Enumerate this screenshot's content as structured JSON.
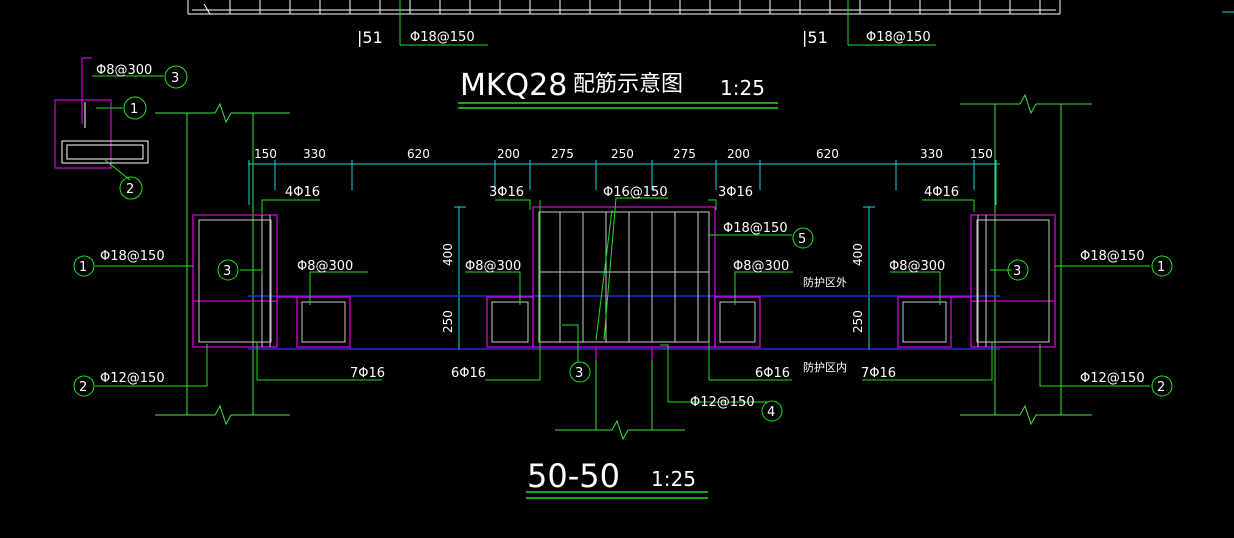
{
  "colors": {
    "background": "#000000",
    "text": "#ffffff",
    "leader": "#1fe01f",
    "concrete_outline": "#d000d0",
    "rebar": "#c8c8c8",
    "dimension": "#14d8d8",
    "protection_zone": "#3030ff",
    "axis_lines": "#40e040"
  },
  "top_strip": {
    "left": {
      "section_mark": "|51",
      "rebar_label": "Φ18@150"
    },
    "right": {
      "section_mark": "|51",
      "rebar_label": "Φ18@150"
    }
  },
  "plan_title": {
    "name": "MKQ28",
    "subtitle": "配筋示意图",
    "scale": "1:25"
  },
  "section_title": {
    "name": "50-50",
    "scale": "1:25"
  },
  "legend_detail": {
    "label": "Φ8@300",
    "marks": [
      "3",
      "1",
      "2"
    ]
  },
  "dimensions": [
    "150",
    "330",
    "620",
    "200",
    "275",
    "250",
    "275",
    "200",
    "620",
    "330",
    "150"
  ],
  "vertical_dimensions": {
    "left": [
      "400",
      "250"
    ],
    "right": [
      "400",
      "250"
    ]
  },
  "zones": {
    "outside": "防护区外",
    "inside": "防护区内"
  },
  "rebar_labels": {
    "left_corner": "4Φ16",
    "left_col_top": "3Φ16",
    "center_main": "Φ16@150",
    "right_col_top": "3Φ16",
    "right_corner": "4Φ16",
    "right_inner_horizontal": "Φ18@150",
    "left_tie": "Φ8@300",
    "left_center_tie": "Φ8@300",
    "right_center_tie": "Φ8@300",
    "right_tie": "Φ8@300",
    "left_outer_horizontal": "Φ18@150",
    "right_outer_horizontal": "Φ18@150",
    "left_vertical": "Φ12@150",
    "right_vertical": "Φ12@150",
    "left_bottom": "7Φ16",
    "left_center_bottom": "6Φ16",
    "right_center_bottom": "6Φ16",
    "right_bottom": "7Φ16",
    "center_vertical": "Φ12@150"
  },
  "marks": {
    "left_1": "1",
    "left_2": "2",
    "left_3": "3",
    "right_1": "1",
    "right_2": "2",
    "right_3": "3",
    "center_3": "3",
    "center_4": "4",
    "center_5": "5"
  }
}
